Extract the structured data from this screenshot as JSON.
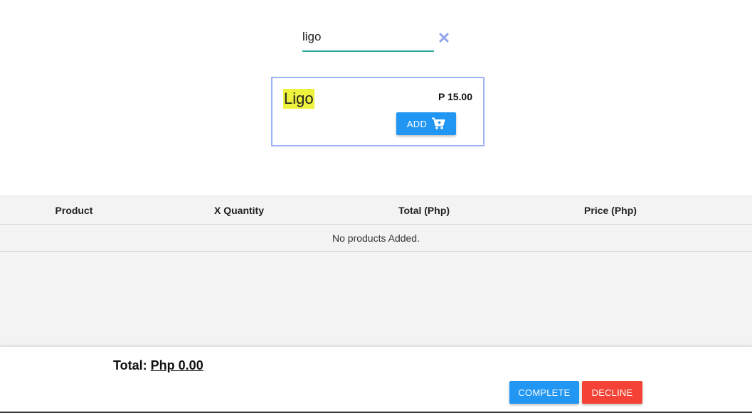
{
  "search": {
    "value": "ligo",
    "placeholder": ""
  },
  "icons": {
    "clear": "close-icon",
    "cart": "cart-plus-icon"
  },
  "result": {
    "name": "Ligo",
    "price": "P 15.00",
    "add_label": "ADD"
  },
  "table": {
    "columns": [
      "Product",
      "X Quantity",
      "Total (Php)",
      "Price (Php)"
    ],
    "empty_message": "No products Added."
  },
  "footer": {
    "total_label": "Total:",
    "total_value": "Php 0.00",
    "complete_label": "COMPLETE",
    "decline_label": "DECLINE"
  },
  "colors": {
    "accent_blue": "#2196f3",
    "decline_red": "#f44336",
    "input_underline": "#26a69a",
    "highlight": "#eef23c",
    "card_border": "#9fb1f7"
  }
}
